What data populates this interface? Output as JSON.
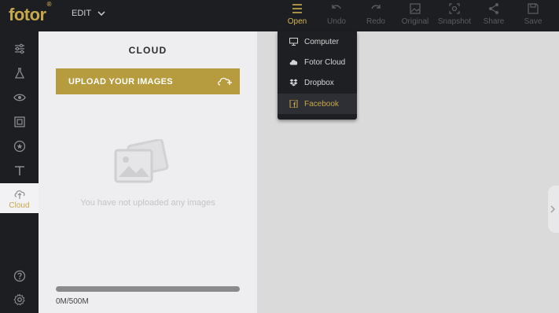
{
  "app": {
    "logo": "fotor",
    "logo_mark": "®"
  },
  "header": {
    "edit_label": "EDIT",
    "tools": [
      {
        "label": "Open",
        "icon": "hamburger-icon",
        "active": true
      },
      {
        "label": "Undo",
        "icon": "undo-icon"
      },
      {
        "label": "Redo",
        "icon": "redo-icon"
      },
      {
        "label": "Original",
        "icon": "image-icon"
      },
      {
        "label": "Snapshot",
        "icon": "camera-icon"
      },
      {
        "label": "Share",
        "icon": "share-icon"
      },
      {
        "label": "Save",
        "icon": "floppy-icon"
      }
    ]
  },
  "sidebar": {
    "items": [
      {
        "icon": "sliders-icon"
      },
      {
        "icon": "flask-icon"
      },
      {
        "icon": "eye-icon"
      },
      {
        "icon": "frame-icon"
      },
      {
        "icon": "sticker-icon"
      },
      {
        "icon": "text-icon"
      },
      {
        "icon": "cloud-icon",
        "label": "Cloud",
        "active": true
      },
      {
        "icon": "help-icon"
      },
      {
        "icon": "settings-icon"
      }
    ]
  },
  "panel": {
    "title": "CLOUD",
    "upload_label": "UPLOAD YOUR IMAGES",
    "empty_message": "You have not uploaded any images",
    "storage_text": "0M/500M",
    "storage_used_fraction": 0
  },
  "open_menu": {
    "items": [
      {
        "label": "Computer",
        "icon": "monitor-icon"
      },
      {
        "label": "Fotor Cloud",
        "icon": "cloud-icon"
      },
      {
        "label": "Dropbox",
        "icon": "dropbox-icon"
      },
      {
        "label": "Facebook",
        "icon": "facebook-icon",
        "highlighted": true
      }
    ]
  },
  "colors": {
    "accent": "#c7a84a",
    "upload_button": "#b79b3f",
    "topbar": "#1d1e22",
    "panel": "#eeeef0",
    "canvas": "#dadada"
  }
}
